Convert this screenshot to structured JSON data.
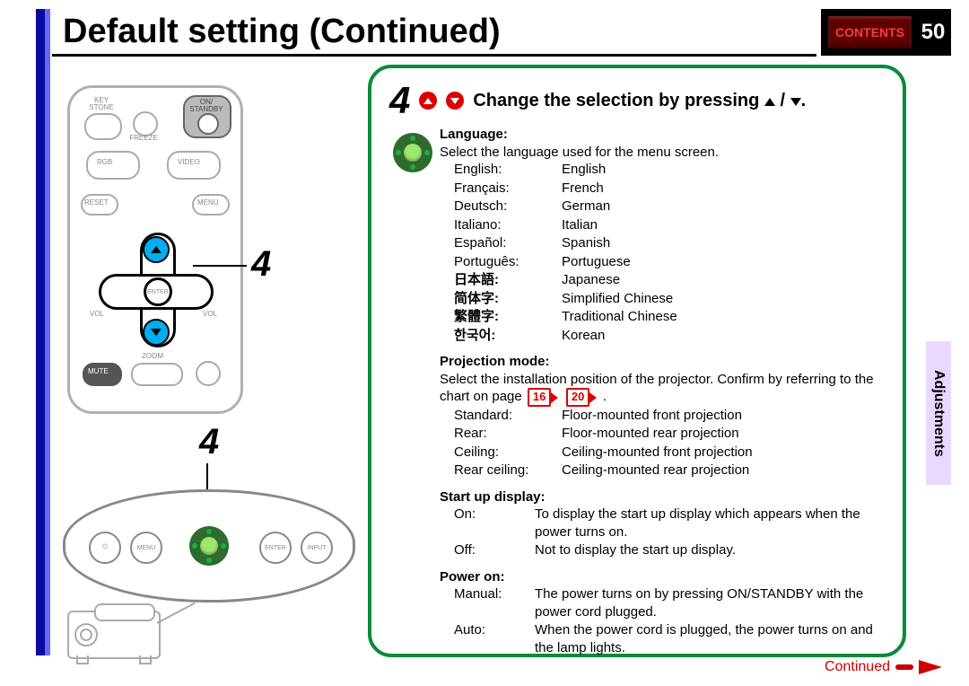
{
  "page": {
    "title": "Default setting (Continued)",
    "contents_label": "CONTENTS",
    "page_number": "50",
    "side_tab": "Adjustments",
    "continued_label": "Continued"
  },
  "remote": {
    "keystone": "KEY\nSTONE",
    "standby": "ON/\nSTANDBY",
    "freeze": "FREEZE",
    "rgb": "RGB",
    "video": "VIDEO",
    "reset": "RESET",
    "menu": "MENU",
    "enter": "ENTER",
    "vol_minus": "VOL",
    "vol_plus": "VOL",
    "zoom": "ZOOM",
    "mute": "MUTE"
  },
  "callouts": {
    "remote_4": "4",
    "panel_4": "4"
  },
  "oval_panel": {
    "menu": "MENU",
    "enter": "ENTER",
    "input": "INPUT"
  },
  "step": {
    "number": "4",
    "title_prefix": "Change the selection by pressing",
    "title_suffix": ".",
    "language": {
      "heading": "Language:",
      "desc": "Select the language used for the menu screen.",
      "rows": [
        {
          "l": "English:",
          "r": "English",
          "bold": false
        },
        {
          "l": "Français:",
          "r": "French",
          "bold": false
        },
        {
          "l": "Deutsch:",
          "r": "German",
          "bold": false
        },
        {
          "l": "Italiano:",
          "r": "Italian",
          "bold": false
        },
        {
          "l": "Español:",
          "r": "Spanish",
          "bold": false
        },
        {
          "l": "Português:",
          "r": "Portuguese",
          "bold": false
        },
        {
          "l": "日本語:",
          "r": "Japanese",
          "bold": true
        },
        {
          "l": "简体字:",
          "r": "Simplified Chinese",
          "bold": true
        },
        {
          "l": "繁體字:",
          "r": "Traditional Chinese",
          "bold": true
        },
        {
          "l": "한국어:",
          "r": "Korean",
          "bold": true
        }
      ]
    },
    "projection": {
      "heading": "Projection mode:",
      "desc_pre": "Select the installation position of the projector. Confirm by referring to the chart on page",
      "ref1": "16",
      "ref2": "20",
      "desc_post": ".",
      "rows": [
        {
          "l": "Standard:",
          "r": "Floor-mounted front projection"
        },
        {
          "l": "Rear:",
          "r": "Floor-mounted rear projection"
        },
        {
          "l": "Ceiling:",
          "r": "Ceiling-mounted front projection"
        },
        {
          "l": "Rear ceiling:",
          "r": "Ceiling-mounted rear projection"
        }
      ]
    },
    "startup": {
      "heading": "Start up display:",
      "rows": [
        {
          "l": "On:",
          "r": "To display the start up display which appears when the power turns on."
        },
        {
          "l": "Off:",
          "r": "Not to display the start up display."
        }
      ]
    },
    "poweron": {
      "heading": "Power on:",
      "rows": [
        {
          "l": "Manual:",
          "r": "The power turns on by pressing ON/STANDBY with the power cord plugged."
        },
        {
          "l": "Auto:",
          "r": "When the power cord is plugged, the power turns on and the lamp lights."
        }
      ]
    }
  }
}
